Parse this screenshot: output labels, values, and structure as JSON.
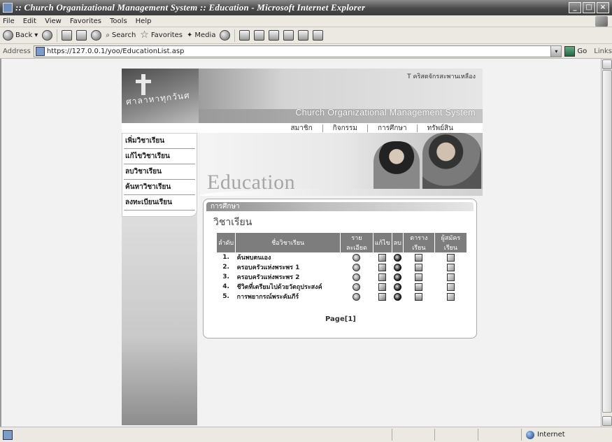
{
  "window": {
    "title": ":: Church Organizational Management System :: Education - Microsoft Internet Explorer"
  },
  "menu": [
    "File",
    "Edit",
    "View",
    "Favorites",
    "Tools",
    "Help"
  ],
  "toolbar": {
    "back": "Back",
    "search": "Search",
    "favorites": "Favorites",
    "media": "Media"
  },
  "address": {
    "label": "Address",
    "url": "https://127.0.0.1/yoo/EducationList.asp",
    "go": "Go",
    "links": "Links"
  },
  "site": {
    "motto": "T คริสตจักรสะพานเหลือง",
    "thai_vertical": "ศาลาหาทุกวันศ",
    "system_name": "Church Organizational Management System",
    "nav": [
      "สมาชิก",
      "กิจกรรม",
      "การศึกษา",
      "ทรัพย์สิน"
    ],
    "side_menu": [
      "เพิ่มวิชาเรียน",
      "แก้ไขวิชาเรียน",
      "ลบวิชาเรียน",
      "ค้นหาวิชาเรียน",
      "ลงทะเบียนเรียน"
    ],
    "banner_title": "Education",
    "panel_tab": "การศึกษา",
    "panel_title": "วิชาเรียน",
    "table": {
      "headers": [
        "ลำดับ",
        "ชื่อวิชาเรียน",
        "รายละเอียด",
        "แก้ไข",
        "ลบ",
        "ตารางเรียน",
        "ผู้สมัครเรียน"
      ],
      "rows": [
        {
          "no": "1.",
          "name": "ค้นพบตนเอง"
        },
        {
          "no": "2.",
          "name": "ครอบครัวแห่งพระพร 1"
        },
        {
          "no": "3.",
          "name": "ครอบครัวแห่งพระพร 2"
        },
        {
          "no": "4.",
          "name": "ชีวิตที่เตรียมไปด้วยวัตถุประสงค์"
        },
        {
          "no": "5.",
          "name": "การพยากรณ์พระคัมภีร์"
        }
      ]
    },
    "pager": "Page[1]"
  },
  "status": {
    "zone": "Internet"
  }
}
